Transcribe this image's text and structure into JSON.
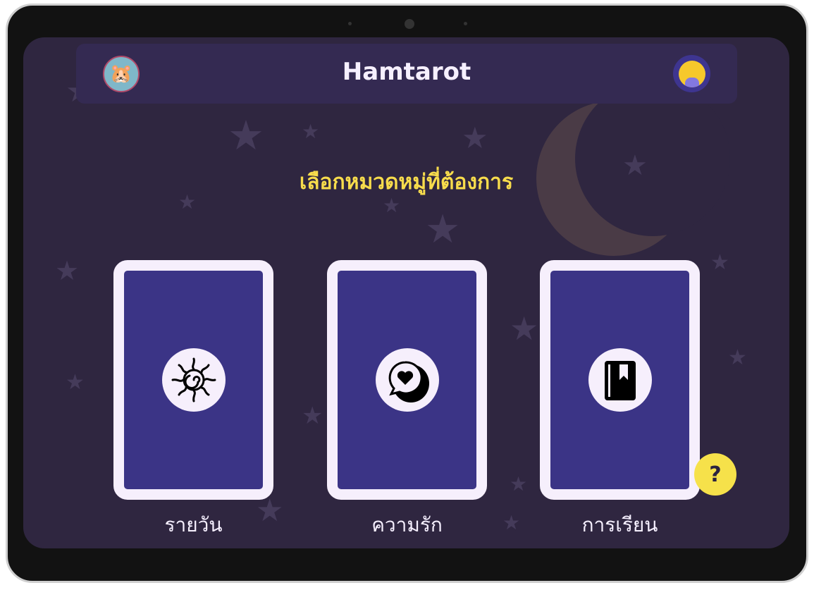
{
  "app": {
    "title": "Hamtarot"
  },
  "page": {
    "heading": "เลือกหมวดหมู่ที่ต้องการ"
  },
  "categories": [
    {
      "label": "รายวัน",
      "icon": "sun-icon"
    },
    {
      "label": "ความรัก",
      "icon": "heart-chat-icon"
    },
    {
      "label": "การเรียน",
      "icon": "book-icon"
    }
  ],
  "help": {
    "label": "?"
  },
  "colors": {
    "accent": "#f7dc4c",
    "card": "#3b3486",
    "background": "#2f2640"
  }
}
